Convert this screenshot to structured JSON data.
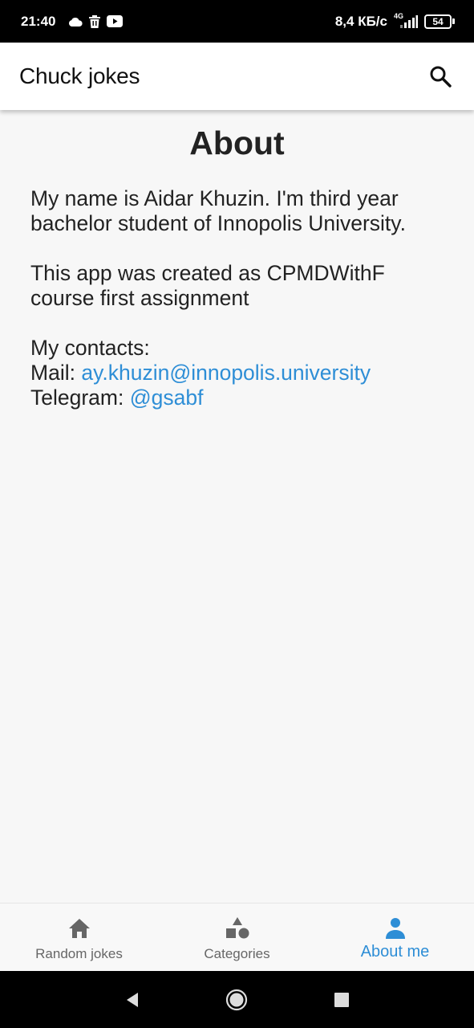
{
  "status_bar": {
    "time": "21:40",
    "network_speed": "8,4 КБ/с",
    "network_type": "4G",
    "battery_level": "54",
    "icons_left": [
      "cloud-icon",
      "trash-icon",
      "youtube-icon"
    ]
  },
  "app_bar": {
    "title": "Chuck jokes",
    "search_icon": "search-icon"
  },
  "about": {
    "heading": "About",
    "intro": "My name is Aidar Khuzin. I'm third year bachelor student of Innopolis University.",
    "purpose": "This app was created as CPMDWithF course first assignment",
    "contacts_label": "My contacts:",
    "mail_label": "Mail: ",
    "mail_value": "ay.khuzin@innopolis.university",
    "telegram_label": "Telegram: ",
    "telegram_value": "@gsabf"
  },
  "bottom_nav": {
    "items": [
      {
        "label": "Random jokes",
        "icon": "home-icon",
        "active": false
      },
      {
        "label": "Categories",
        "icon": "shapes-icon",
        "active": false
      },
      {
        "label": "About me",
        "icon": "person-icon",
        "active": true
      }
    ]
  },
  "colors": {
    "accent": "#2e8ed6",
    "background": "#f7f7f7",
    "app_bar": "#ffffff",
    "inactive": "#666666"
  }
}
